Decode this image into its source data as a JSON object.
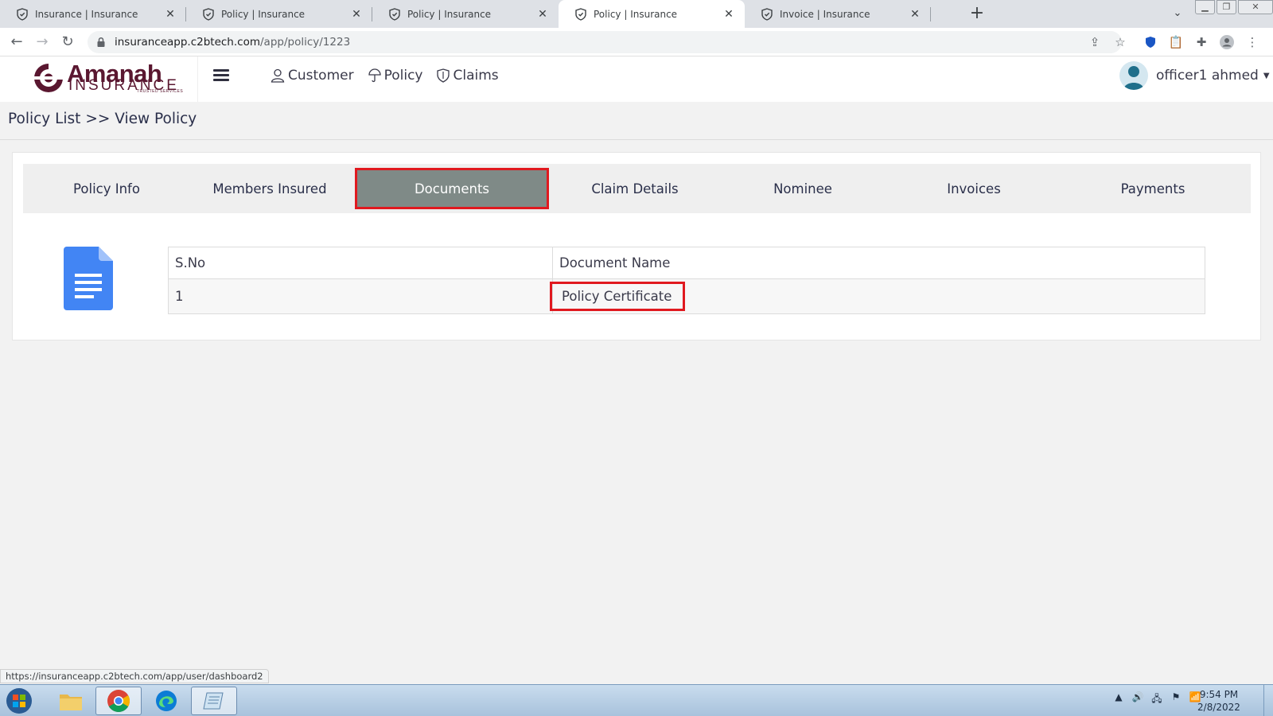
{
  "browser": {
    "tabs": [
      {
        "title": "Insurance | Insurance",
        "active": false
      },
      {
        "title": "Policy | Insurance",
        "active": false
      },
      {
        "title": "Policy | Insurance",
        "active": false
      },
      {
        "title": "Policy | Insurance",
        "active": true
      },
      {
        "title": "Invoice | Insurance",
        "active": false
      }
    ],
    "url_host": "insuranceapp.c2btech.com",
    "url_path": "/app/policy/1223"
  },
  "app": {
    "logo_name": "Amanah",
    "logo_sub": "INSURANCE",
    "logo_tagline": "TRUSTED SERVICES",
    "nav": [
      {
        "label": "Customer",
        "icon": "user-icon"
      },
      {
        "label": "Policy",
        "icon": "umbrella-icon"
      },
      {
        "label": "Claims",
        "icon": "shield-icon"
      }
    ],
    "user_name": "officer1 ahmed"
  },
  "breadcrumb": {
    "parent": "Policy List",
    "separator": ">>",
    "current": "View Policy"
  },
  "policy_tabs": [
    {
      "label": "Policy Info",
      "active": false
    },
    {
      "label": "Members Insured",
      "active": false
    },
    {
      "label": "Documents",
      "active": true
    },
    {
      "label": "Claim Details",
      "active": false
    },
    {
      "label": "Nominee",
      "active": false
    },
    {
      "label": "Invoices",
      "active": false
    },
    {
      "label": "Payments",
      "active": false
    }
  ],
  "documents_table": {
    "headers": [
      "S.No",
      "Document Name"
    ],
    "rows": [
      {
        "sno": "1",
        "name": "Policy Certificate"
      }
    ]
  },
  "status_bar_url": "https://insuranceapp.c2btech.com/app/user/dashboard2",
  "taskbar": {
    "time": "9:54 PM",
    "date": "2/8/2022"
  },
  "colors": {
    "brand": "#5a1730",
    "active_tab_bg": "#7f8a87",
    "highlight": "#e0191f"
  }
}
